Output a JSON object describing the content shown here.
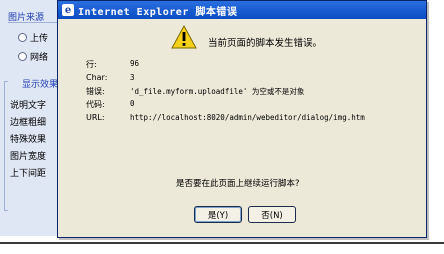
{
  "background": {
    "group_title": "图片来源",
    "radio_upload": "上传",
    "radio_network": "网络",
    "section_title": "显示效果",
    "labels": [
      "说明文字",
      "边框粗细",
      "特殊效果",
      "图片宽度",
      "上下间距"
    ]
  },
  "dialog": {
    "title": "Internet Explorer 脚本错误",
    "headline": "当前页面的脚本发生错误。",
    "rows": [
      {
        "label": "行:",
        "value": "96"
      },
      {
        "label": "Char:",
        "value": "3"
      },
      {
        "label": "错误:",
        "value": "'d_file.myform.uploadfile' 为空或不是对象"
      },
      {
        "label": "代码:",
        "value": "0"
      },
      {
        "label": "URL:",
        "value": "http://localhost:8020/admin/webeditor/dialog/img.htm"
      }
    ],
    "question": "是否要在此页面上继续运行脚本?",
    "yes_label": "是(Y)",
    "no_label": "否(N)"
  },
  "colors": {
    "titlebar": "#0a4cc4",
    "dialog_bg": "#ece9d8",
    "link_blue": "#1f3fb5"
  },
  "icons": {
    "title": "ie-logo-icon",
    "warning": "warning-triangle-icon"
  }
}
